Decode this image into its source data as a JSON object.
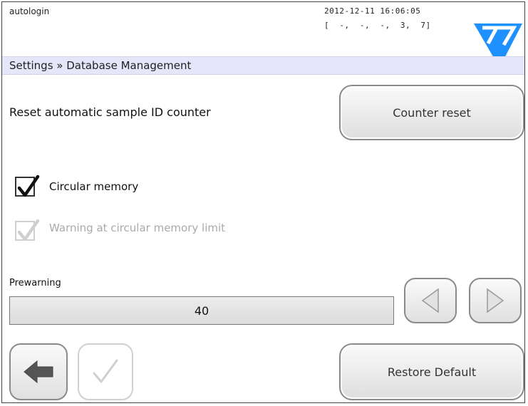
{
  "status": {
    "user": "autologin",
    "datetime": "2012-12-11 16:06:05",
    "counters": "[  -,  -,  -,  3,  7]"
  },
  "breadcrumb": "Settings » Database Management",
  "reset_counter": {
    "label": "Reset automatic sample ID counter",
    "button_label": "Counter reset"
  },
  "circular_memory": {
    "label": "Circular memory",
    "checked": true
  },
  "warning_limit": {
    "label": "Warning at circular memory limit",
    "checked": true,
    "disabled": true
  },
  "prewarning": {
    "label": "Prewarning",
    "value": "40"
  },
  "footer": {
    "restore_label": "Restore Default"
  },
  "colors": {
    "breadcrumb_bg": "#e6e6fa",
    "logo_blue": "#1e90ff"
  },
  "icons": {
    "logo": "77-logo-icon",
    "left_arrow": "triangle-left-icon",
    "right_arrow": "triangle-right-icon",
    "back": "back-arrow-icon",
    "confirm": "checkmark-icon"
  }
}
